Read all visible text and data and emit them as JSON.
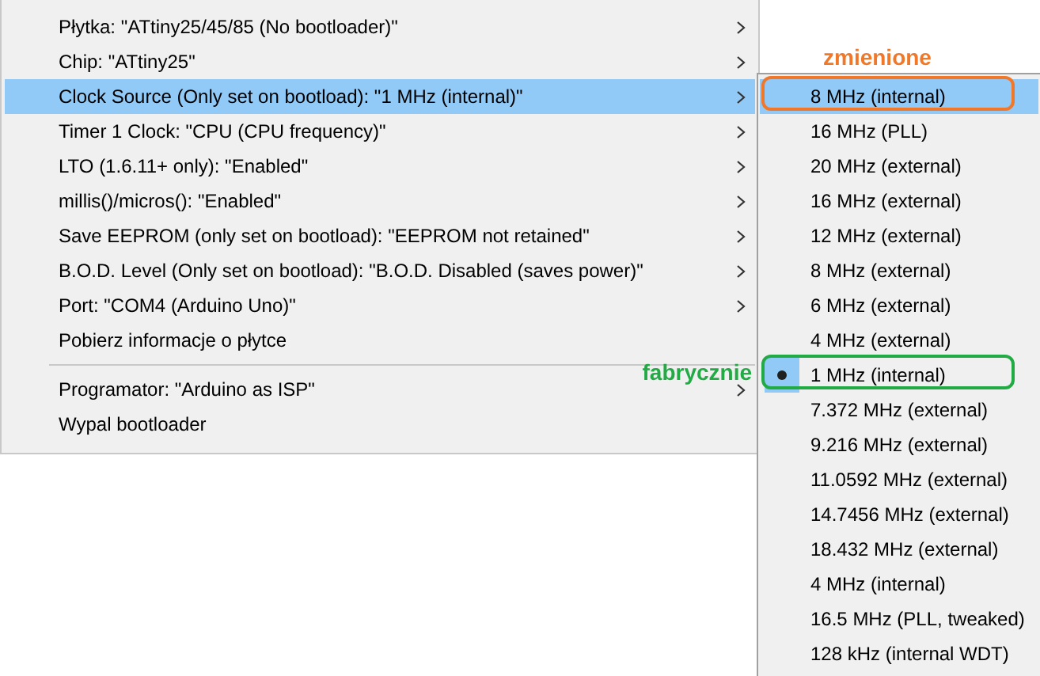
{
  "menu": {
    "items": [
      {
        "kind": "item",
        "label": "Płytka: \"ATtiny25/45/85 (No bootloader)\"",
        "submenu": true,
        "selected": false
      },
      {
        "kind": "item",
        "label": "Chip: \"ATtiny25\"",
        "submenu": true,
        "selected": false
      },
      {
        "kind": "item",
        "label": "Clock Source (Only set on bootload): \"1 MHz (internal)\"",
        "submenu": true,
        "selected": true
      },
      {
        "kind": "item",
        "label": "Timer 1 Clock: \"CPU (CPU frequency)\"",
        "submenu": true,
        "selected": false
      },
      {
        "kind": "item",
        "label": "LTO (1.6.11+ only): \"Enabled\"",
        "submenu": true,
        "selected": false
      },
      {
        "kind": "item",
        "label": "millis()/micros(): \"Enabled\"",
        "submenu": true,
        "selected": false
      },
      {
        "kind": "item",
        "label": "Save EEPROM (only set on bootload): \"EEPROM not retained\"",
        "submenu": true,
        "selected": false
      },
      {
        "kind": "item",
        "label": "B.O.D. Level (Only set on bootload): \"B.O.D. Disabled (saves power)\"",
        "submenu": true,
        "selected": false
      },
      {
        "kind": "item",
        "label": "Port: \"COM4 (Arduino Uno)\"",
        "submenu": true,
        "selected": false
      },
      {
        "kind": "item",
        "label": "Pobierz informacje o płytce",
        "submenu": false,
        "selected": false
      },
      {
        "kind": "separator"
      },
      {
        "kind": "item",
        "label": "Programator: \"Arduino as ISP\"",
        "submenu": true,
        "selected": false
      },
      {
        "kind": "item",
        "label": "Wypal bootloader",
        "submenu": false,
        "selected": false
      }
    ]
  },
  "submenu": {
    "items": [
      {
        "label": "8 MHz (internal)",
        "selected": true,
        "checked": false,
        "annotation": {
          "text": "zmienione",
          "color": "#f07828"
        }
      },
      {
        "label": "16 MHz (PLL)",
        "selected": false,
        "checked": false
      },
      {
        "label": "20 MHz (external)",
        "selected": false,
        "checked": false
      },
      {
        "label": "16 MHz (external)",
        "selected": false,
        "checked": false
      },
      {
        "label": "12 MHz (external)",
        "selected": false,
        "checked": false
      },
      {
        "label": "8 MHz (external)",
        "selected": false,
        "checked": false
      },
      {
        "label": "6 MHz (external)",
        "selected": false,
        "checked": false
      },
      {
        "label": "4 MHz (external)",
        "selected": false,
        "checked": false
      },
      {
        "label": "1 MHz (internal)",
        "selected": false,
        "checked": true,
        "annotation": {
          "text": "fabrycznie",
          "color": "#22aa44"
        }
      },
      {
        "label": "7.372 MHz (external)",
        "selected": false,
        "checked": false
      },
      {
        "label": "9.216 MHz (external)",
        "selected": false,
        "checked": false
      },
      {
        "label": "11.0592 MHz (external)",
        "selected": false,
        "checked": false
      },
      {
        "label": "14.7456 MHz (external)",
        "selected": false,
        "checked": false
      },
      {
        "label": "18.432 MHz (external)",
        "selected": false,
        "checked": false
      },
      {
        "label": "4 MHz (internal)",
        "selected": false,
        "checked": false
      },
      {
        "label": "16.5 MHz (PLL, tweaked)",
        "selected": false,
        "checked": false
      },
      {
        "label": "128 kHz (internal WDT)",
        "selected": false,
        "checked": false
      }
    ]
  }
}
